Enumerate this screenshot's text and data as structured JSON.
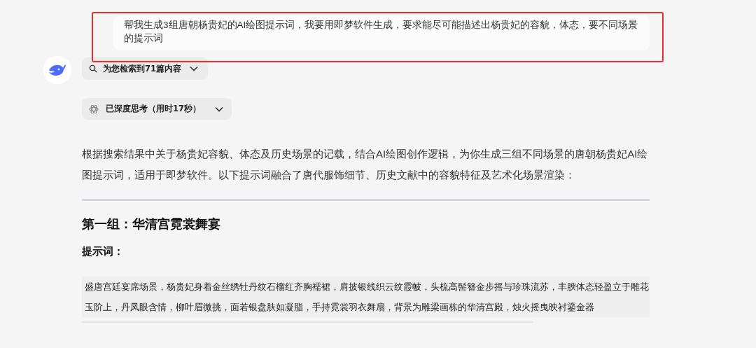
{
  "user_message": {
    "text": "帮我生成3组唐朝杨贵妃的AI绘图提示词，我要用即梦软件生成，要求能尽可能描述出杨贵妃的容貌，体态，要不同场景的提示词",
    "highlighted": true
  },
  "assistant": {
    "search_toggle": {
      "label": "为您检索到71篇内容",
      "expanded": false
    },
    "thinking_toggle": {
      "label": "已深度思考（用时17秒）",
      "expanded": false
    },
    "intro": "根据搜索结果中关于杨贵妃容貌、体态及历史场景的记载，结合AI绘图创作逻辑，为你生成三组不同场景的唐朝杨贵妃AI绘图提示词，适用于即梦软件。以下提示词融合了唐代服饰细节、历史文献中的容貌特征及艺术化场景渲染：",
    "sections": [
      {
        "heading": "第一组：华清宫霓裳舞宴",
        "label": "提示词：",
        "prompt": "盛唐宫廷宴席场景，杨贵妃身着金丝绣牡丹纹石榴红齐胸襦裙，肩披银线织云纹霞帔，头梳高髻簪金步摇与珍珠流苏，丰腴体态轻盈立于雕花玉阶上，丹凤眼含情，柳叶眉微挑，面若银盘肤如凝脂，手持霓裳羽衣舞扇，背景为雕梁画栋的华清宫殿，烛火摇曳映衬鎏金器"
      }
    ]
  }
}
